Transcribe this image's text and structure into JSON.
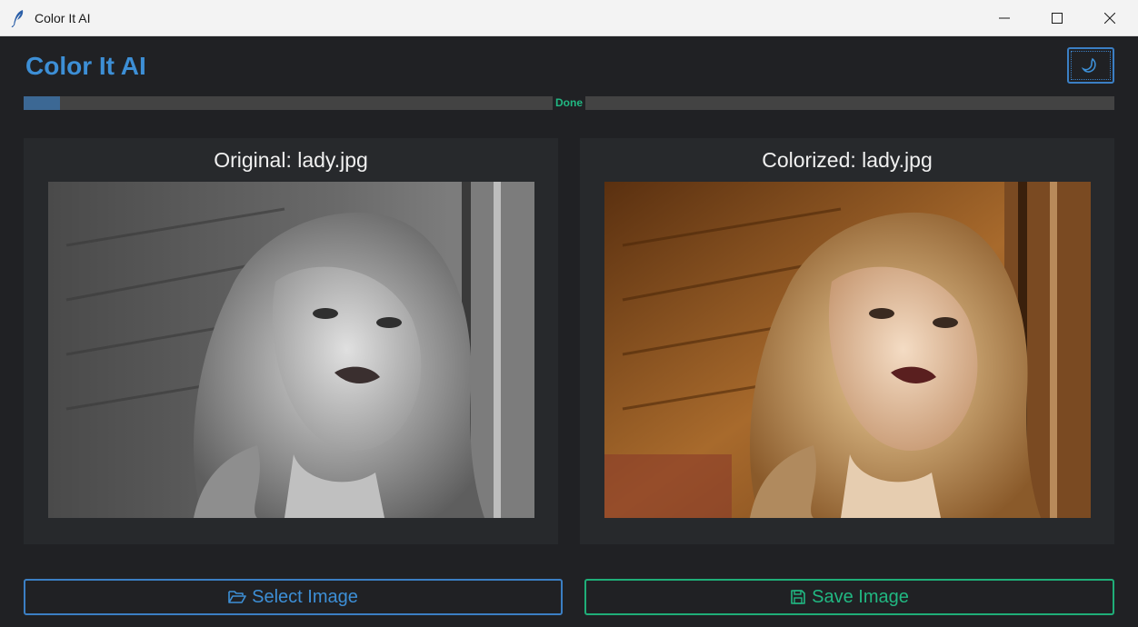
{
  "window": {
    "title": "Color It AI"
  },
  "header": {
    "app_title": "Color It AI",
    "theme_toggle_icon": "moon-icon"
  },
  "progress": {
    "value": 0.033,
    "label": "Done"
  },
  "panels": {
    "original": {
      "title": "Original: lady.jpg",
      "image_desc": "grayscale portrait"
    },
    "colorized": {
      "title": "Colorized: lady.jpg",
      "image_desc": "sepia-toned colorized portrait"
    }
  },
  "buttons": {
    "select_label": "Select Image",
    "select_icon": "folder-open-icon",
    "save_label": "Save Image",
    "save_icon": "save-icon"
  },
  "colors": {
    "accent_blue": "#3d8fd6",
    "accent_green": "#21b882",
    "background": "#202124",
    "panel": "#27292c",
    "progress_fill": "#3c6894"
  }
}
